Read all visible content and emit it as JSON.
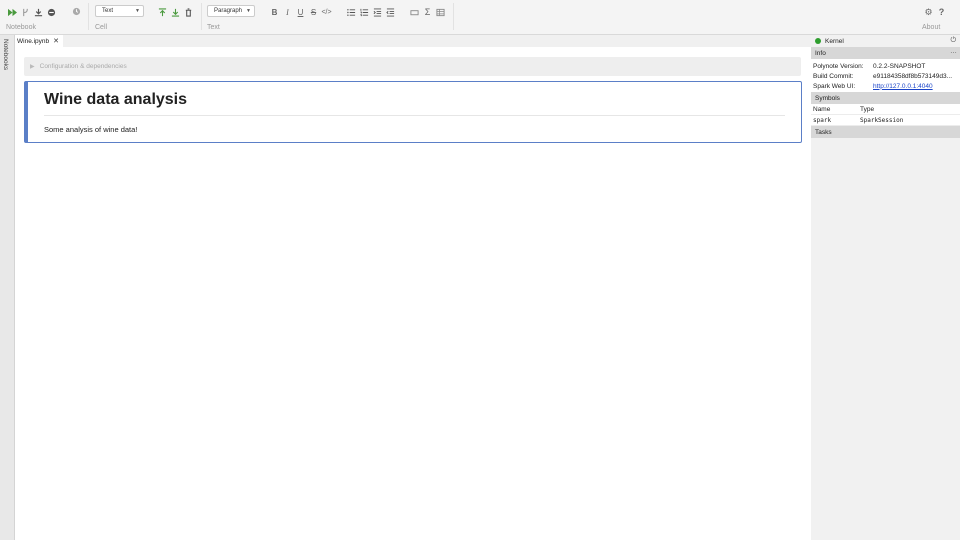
{
  "toolbar": {
    "groups": {
      "notebook": "Notebook",
      "cell": "Cell",
      "text": "Text",
      "about": "About"
    },
    "cell_type_select": "Text",
    "paragraph_select": "Paragraph",
    "accent": "#4a9a3e"
  },
  "left_rail": {
    "label": "Notebooks"
  },
  "tabs": [
    {
      "label": "Wine.ipynb"
    }
  ],
  "config": {
    "label": "Configuration & dependencies"
  },
  "cell": {
    "heading": "Wine data analysis",
    "body": "Some analysis of wine data!",
    "border_color": "#5b7fc7"
  },
  "kernel": {
    "title": "Kernel",
    "status_color": "#2e9e2e",
    "info_title": "Info",
    "info": [
      {
        "key": "Polynote Version:",
        "value": "0.2.2-SNAPSHOT"
      },
      {
        "key": "Build Commit:",
        "value": "e91184358df8b573149d3..."
      },
      {
        "key": "Spark Web UI:",
        "value": "http://127.0.0.1:4040"
      }
    ],
    "symbols_title": "Symbols",
    "symbols_headers": {
      "name": "Name",
      "type": "Type"
    },
    "symbols": [
      {
        "name": "spark",
        "type": "SparkSession"
      }
    ],
    "tasks_title": "Tasks"
  }
}
